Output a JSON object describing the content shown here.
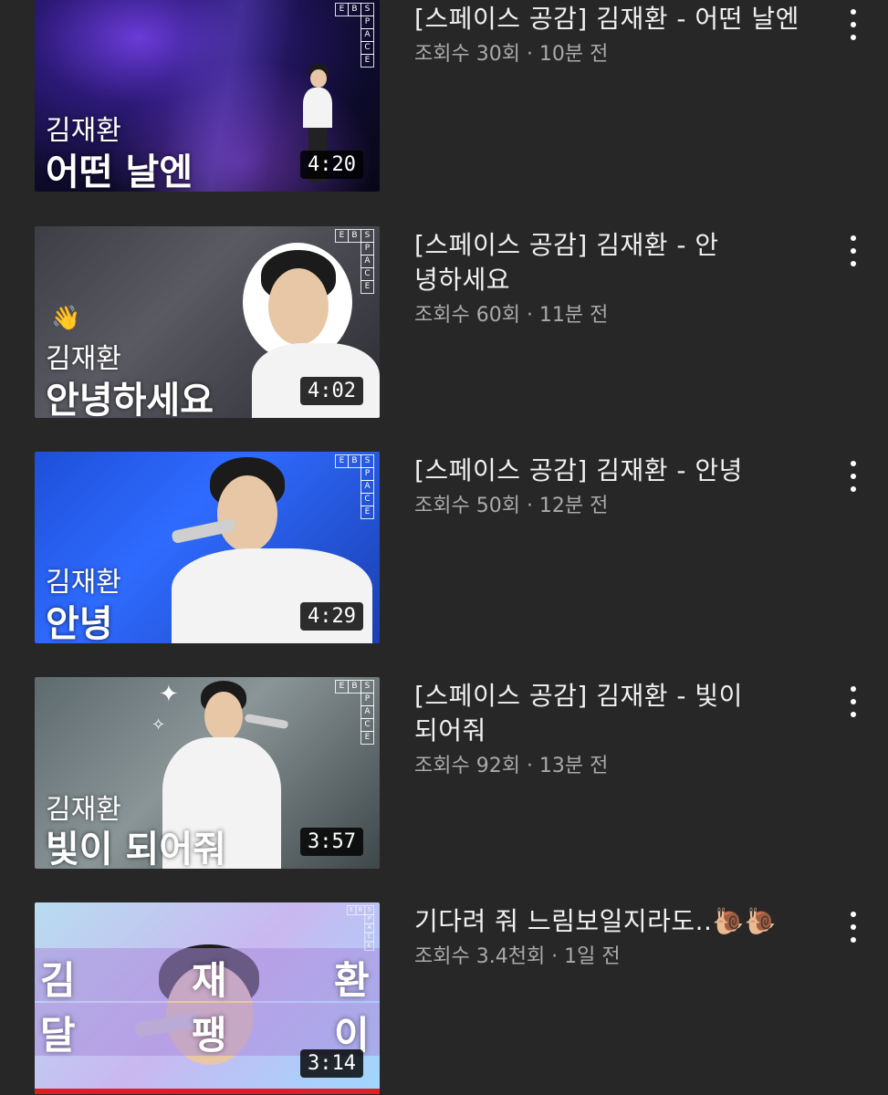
{
  "videos": [
    {
      "title": "[스페이스 공감] 김재환 - 어떤 날엔",
      "stats": "조회수 30회 · 10분 전",
      "thumb_artist": "김재환",
      "thumb_song": "어떤 날엔",
      "duration": "4:20",
      "icon": "more-vert-icon"
    },
    {
      "title": "[스페이스 공감] 김재환 - 안녕하세요",
      "stats": "조회수 60회 · 11분 전",
      "thumb_artist": "김재환",
      "thumb_song": "안녕하세요",
      "thumb_emoji": "👋",
      "duration": "4:02",
      "icon": "more-vert-icon"
    },
    {
      "title": "[스페이스 공감] 김재환 - 안녕",
      "stats": "조회수 50회 · 12분 전",
      "thumb_artist": "김재환",
      "thumb_song": "안녕",
      "duration": "4:29",
      "icon": "more-vert-icon"
    },
    {
      "title": "[스페이스 공감] 김재환 - 빛이 되어줘",
      "stats": "조회수 92회 · 13분 전",
      "thumb_artist": "김재환",
      "thumb_song": "빛이 되어줘",
      "duration": "3:57",
      "icon": "more-vert-icon"
    },
    {
      "title": "기다려 줘 느림보일지라도..🐌🐌",
      "stats": "조회수 3.4천회 · 1일 전",
      "thumb_chars_top": [
        "김",
        "재",
        "환"
      ],
      "thumb_chars_bottom": [
        "달",
        "팽",
        "이"
      ],
      "duration": "3:14",
      "icon": "more-vert-icon",
      "watched": true
    }
  ],
  "ebs_badge": {
    "top": [
      "E",
      "B",
      "S"
    ],
    "side": [
      "P",
      "A",
      "C",
      "E"
    ]
  },
  "colors": {
    "background": "#272727",
    "title_text": "#f1f1f1",
    "stats_text": "#aaaaaa",
    "progress": "#e02020"
  }
}
